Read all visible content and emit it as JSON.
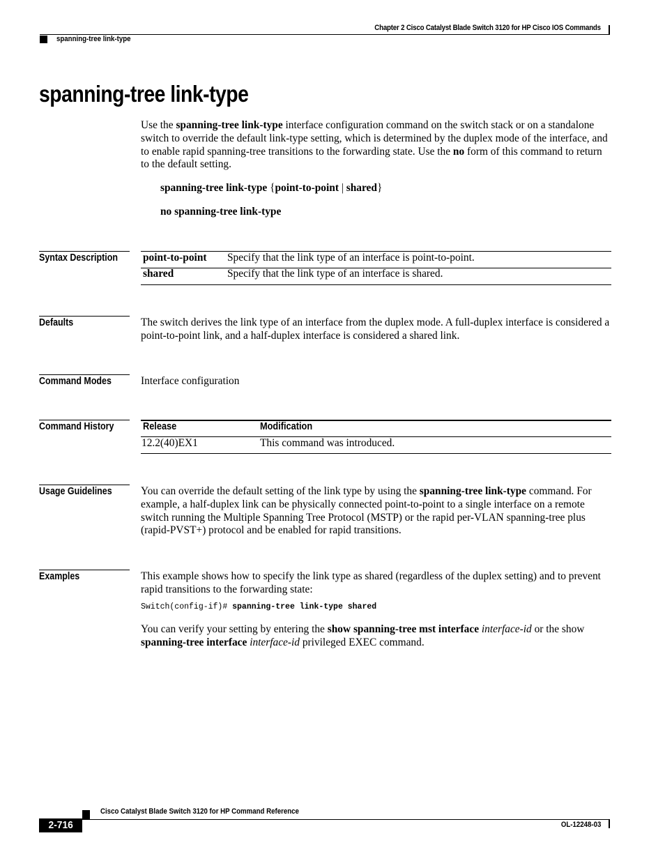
{
  "header": {
    "chapter": "Chapter  2 Cisco Catalyst Blade Switch 3120 for HP Cisco IOS Commands",
    "topic": "spanning-tree link-type"
  },
  "title": "spanning-tree link-type",
  "intro": {
    "p1_a": "Use the ",
    "p1_b": "spanning-tree link-type",
    "p1_c": " interface configuration command on the switch stack or on a standalone switch to override the default link-type setting, which is determined by the duplex mode of the interface, and to enable rapid spanning-tree transitions to the forwarding state. Use the ",
    "p1_d": "no",
    "p1_e": " form of this command to return to the default setting."
  },
  "syntax": {
    "line1_cmd": "spanning-tree link-type ",
    "line1_open": "{",
    "line1_opt1": "point-to-point",
    "line1_sep": " | ",
    "line1_opt2": "shared",
    "line1_close": "}",
    "line2": "no spanning-tree link-type"
  },
  "sections": {
    "syntax_description": {
      "label": "Syntax Description",
      "rows": [
        {
          "keyword": "point-to-point",
          "description": "Specify that the link type of an interface is point-to-point."
        },
        {
          "keyword": "shared",
          "description": "Specify that the link type of an interface is shared."
        }
      ]
    },
    "defaults": {
      "label": "Defaults",
      "text": "The switch derives the link type of an interface from the duplex mode. A full-duplex interface is considered a point-to-point link, and a half-duplex interface is considered a shared link."
    },
    "command_modes": {
      "label": "Command Modes",
      "text": "Interface configuration"
    },
    "command_history": {
      "label": "Command History",
      "headers": [
        "Release",
        "Modification"
      ],
      "rows": [
        {
          "release": "12.2(40)EX1",
          "modification": "This command was introduced."
        }
      ]
    },
    "usage_guidelines": {
      "label": "Usage Guidelines",
      "t1": "You can override the default setting of the link type by using the ",
      "t2": "spanning-tree link-type",
      "t3": " command. For example, a half-duplex link can be physically connected point-to-point to a single interface on a remote switch running the Multiple Spanning Tree Protocol (MSTP) or the rapid per-VLAN spanning-tree plus (rapid-PVST+) protocol and be enabled for rapid transitions."
    },
    "examples": {
      "label": "Examples",
      "text": "This example shows how to specify the link type as shared (regardless of the duplex setting) and to prevent rapid transitions to the forwarding state:",
      "code_prompt": "Switch(config-if)# ",
      "code_cmd": "spanning-tree link-type shared",
      "v1": "You can verify your setting by entering the ",
      "v2": "show spanning-tree mst interface",
      "v3": " ",
      "v4": "interface-id",
      "v5": " or the show ",
      "v6": "spanning-tree interface",
      "v7": " ",
      "v8": "interface-id",
      "v9": " privileged EXEC command."
    }
  },
  "footer": {
    "title": "Cisco Catalyst Blade Switch 3120 for HP Command Reference",
    "page": "2-716",
    "doc_id": "OL-12248-03"
  }
}
